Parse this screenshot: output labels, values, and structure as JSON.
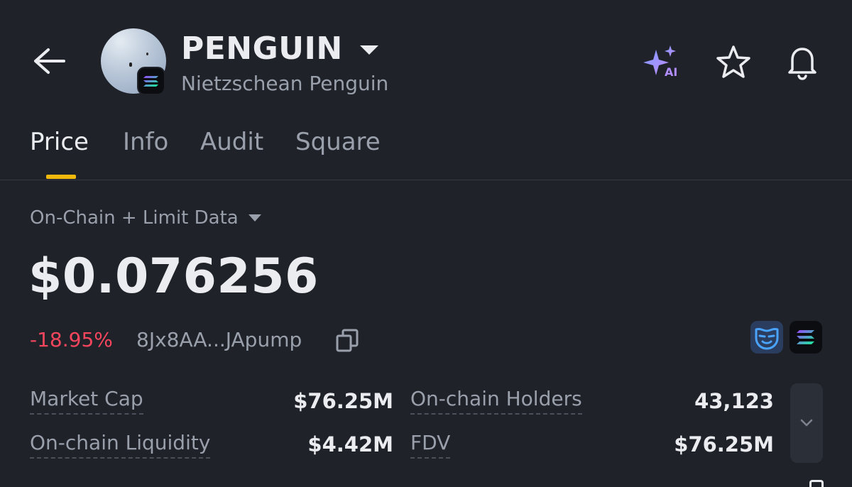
{
  "header": {
    "title": "PENGUIN",
    "subtitle": "Nietzschean Penguin",
    "ai_label": "AI"
  },
  "tabs": [
    {
      "label": "Price",
      "active": true
    },
    {
      "label": "Info",
      "active": false
    },
    {
      "label": "Audit",
      "active": false
    },
    {
      "label": "Square",
      "active": false
    }
  ],
  "data_source": "On-Chain + Limit Data",
  "price": "$0.076256",
  "change": "-18.95%",
  "contract_address": "8Jx8AA...JApump",
  "stats": {
    "market_cap": {
      "label": "Market Cap",
      "value": "$76.25M"
    },
    "holders": {
      "label": "On-chain Holders",
      "value": "43,123"
    },
    "liquidity": {
      "label": "On-chain Liquidity",
      "value": "$4.42M"
    },
    "fdv": {
      "label": "FDV",
      "value": "$76.25M"
    }
  },
  "colors": {
    "background": "#1f2229",
    "accent": "#f0b90b",
    "negative": "#f6465d",
    "text_primary": "#eaecef",
    "text_secondary": "#9aa0ab"
  },
  "icons": [
    "back-arrow-icon",
    "solana-icon",
    "ai-sparkle-icon",
    "star-icon",
    "bell-icon",
    "copy-icon",
    "mask-icon",
    "chevron-down-icon"
  ]
}
